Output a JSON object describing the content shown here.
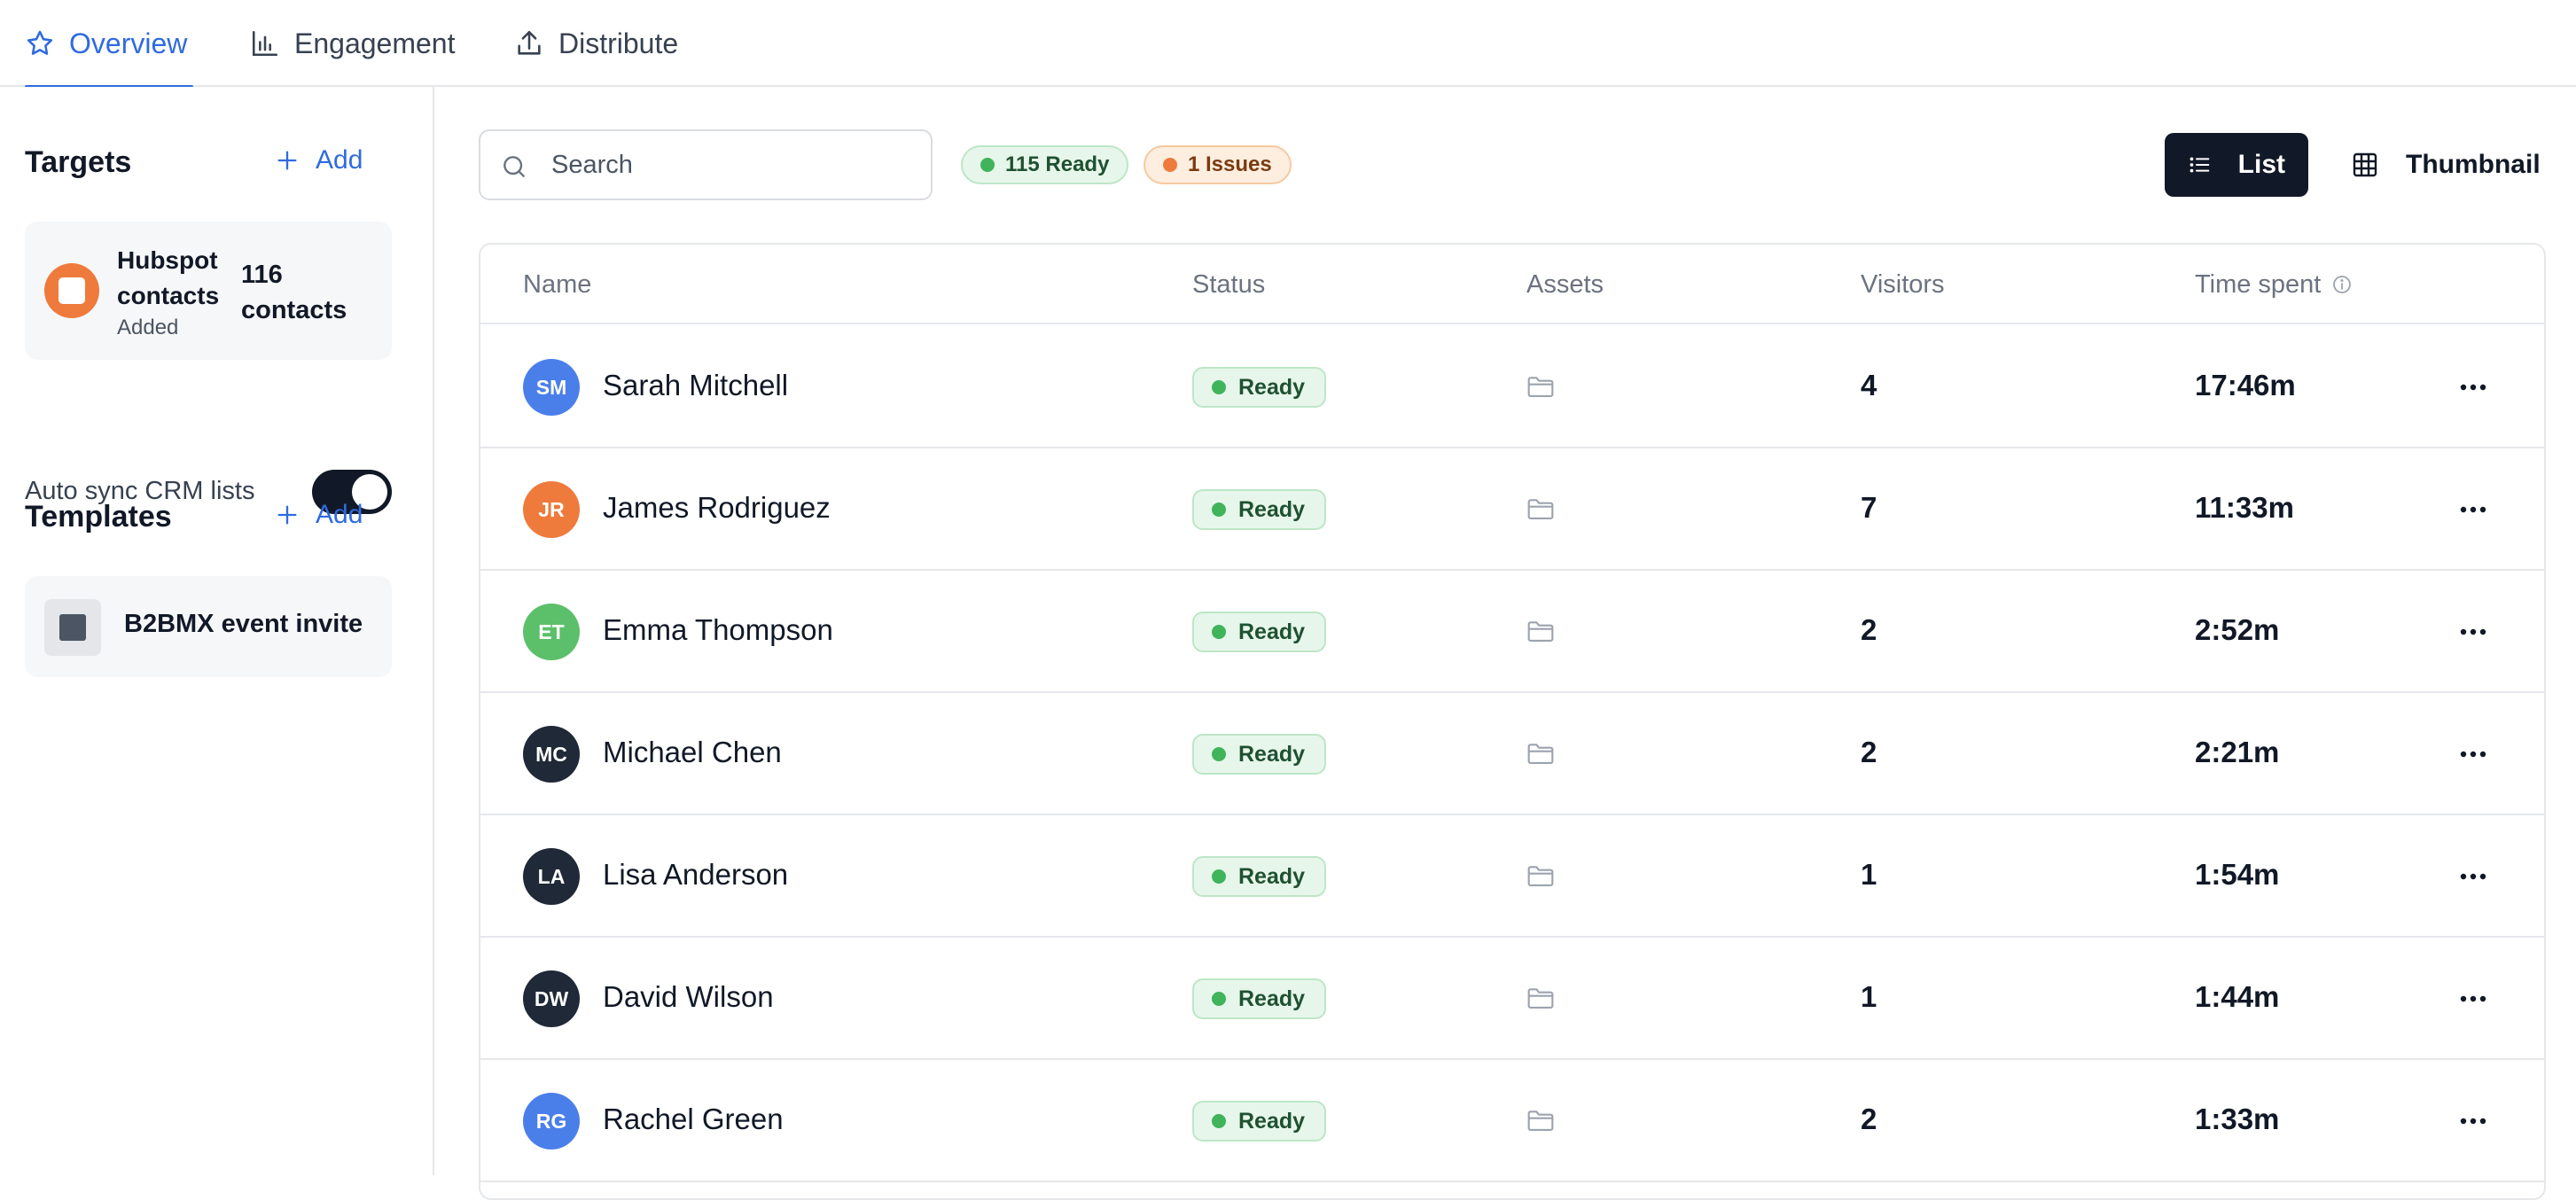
{
  "tabs": [
    {
      "label": "Overview",
      "icon": "star-icon",
      "active": true
    },
    {
      "label": "Engagement",
      "icon": "bar-chart-icon",
      "active": false
    },
    {
      "label": "Distribute",
      "icon": "upload-icon",
      "active": false
    }
  ],
  "sidebar": {
    "targets": {
      "heading": "Targets",
      "add_label": "Add",
      "source": {
        "name": "Hubspot contacts",
        "status": "Added",
        "count": "116 contacts",
        "color": "#ee7a3c"
      },
      "auto_sync_label": "Auto sync CRM lists",
      "auto_sync_on": true
    },
    "templates": {
      "heading": "Templates",
      "add_label": "Add",
      "items": [
        {
          "name": "B2BMX event invite"
        }
      ]
    }
  },
  "toolbar": {
    "search_placeholder": "Search",
    "search_value": "",
    "ready_badge": "115 Ready",
    "issues_badge": "1 Issues",
    "view_list_label": "List",
    "view_thumbnail_label": "Thumbnail",
    "active_view": "List"
  },
  "table": {
    "columns": [
      "Name",
      "Status",
      "Assets",
      "Visitors",
      "Time spent"
    ],
    "rows": [
      {
        "initials": "SM",
        "name": "Sarah Mitchell",
        "status": "Ready",
        "visitors": "4",
        "time": "17:46m",
        "avatar_color": "#4a7fea"
      },
      {
        "initials": "JR",
        "name": "James Rodriguez",
        "status": "Ready",
        "visitors": "7",
        "time": "11:33m",
        "avatar_color": "#ee7a3c"
      },
      {
        "initials": "ET",
        "name": "Emma Thompson",
        "status": "Ready",
        "visitors": "2",
        "time": "2:52m",
        "avatar_color": "#5cc06a"
      },
      {
        "initials": "MC",
        "name": "Michael Chen",
        "status": "Ready",
        "visitors": "2",
        "time": "2:21m",
        "avatar_color": "#1f2937"
      },
      {
        "initials": "LA",
        "name": "Lisa Anderson",
        "status": "Ready",
        "visitors": "1",
        "time": "1:54m",
        "avatar_color": "#1f2937"
      },
      {
        "initials": "DW",
        "name": "David Wilson",
        "status": "Ready",
        "visitors": "1",
        "time": "1:44m",
        "avatar_color": "#1f2937"
      },
      {
        "initials": "RG",
        "name": "Rachel Green",
        "status": "Ready",
        "visitors": "2",
        "time": "1:33m",
        "avatar_color": "#4a7fea"
      }
    ]
  },
  "colors": {
    "accent": "#2f6bdf",
    "ready": "#3fb45b",
    "issues": "#ee7a3c",
    "dark": "#111827"
  }
}
